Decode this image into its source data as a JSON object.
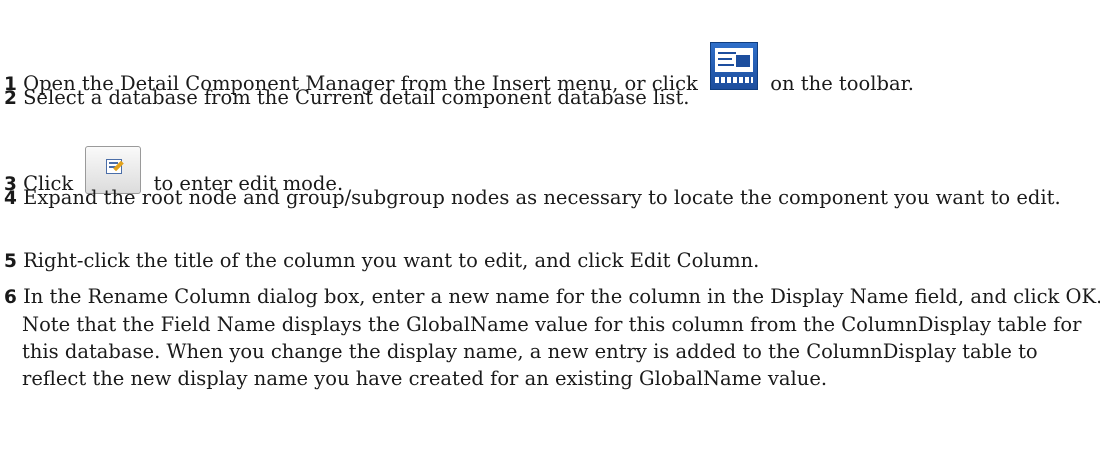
{
  "steps": [
    {
      "num": "1",
      "text_before": "Open the Detail Component Manager from the Insert menu, or click",
      "icon": "detail-component-manager-icon",
      "text_after": "on the toolbar."
    },
    {
      "num": "2",
      "text": "Select a database from the Current detail component database list."
    },
    {
      "num": "3",
      "text_before": "Click",
      "icon": "edit-mode-icon",
      "text_after": "to enter edit mode."
    },
    {
      "num": "4",
      "text": "Expand the root node and group/subgroup nodes as necessary to locate the component you want to edit."
    },
    {
      "num": "5",
      "text": "Right-click the title of the column you want to edit, and click Edit Column."
    },
    {
      "num": "6",
      "text": "In the Rename Column dialog box, enter a new name for the column in the Display Name field, and click OK. Note that the Field Name displays the GlobalName value for this column from the ColumnDisplay table for this database. When you change the display name, a new entry is added to the ColumnDisplay table to reflect the new display name you have created for an existing GlobalName value."
    }
  ]
}
